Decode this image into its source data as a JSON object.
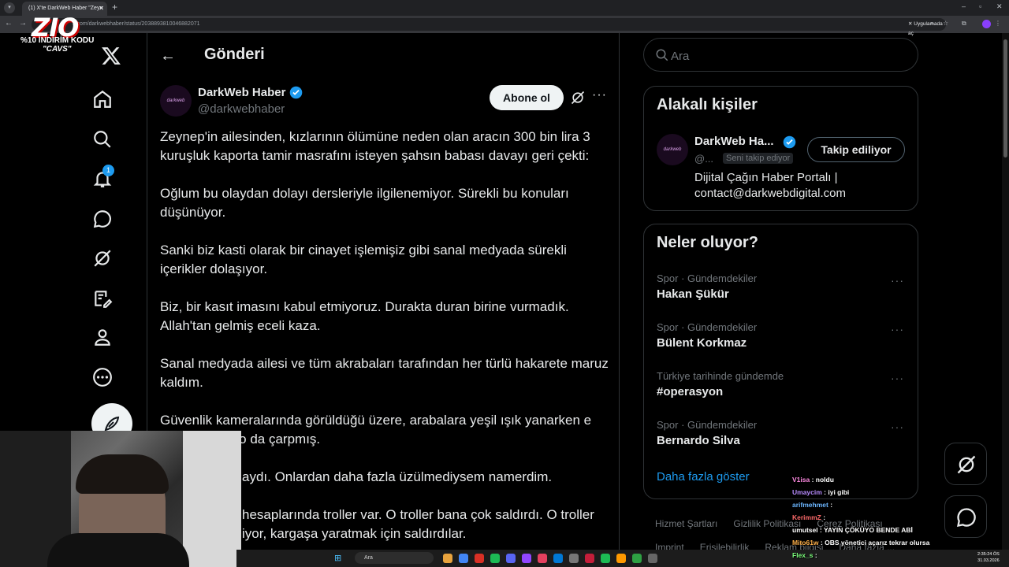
{
  "browser": {
    "tab_title": "(1) X'te DarkWeb Haber \"Zeyn",
    "url": "x.com/darkwebhaber/status/2038893810046882071",
    "app_chip": "Uygulamada aç"
  },
  "overlay_logo": {
    "brand": "ZIO",
    "line1": "%10 İNDİRİM KODU",
    "line2": "\"CAVS\""
  },
  "leftnav": {
    "items": [
      "home-icon",
      "search-icon",
      "bell-icon",
      "chat-icon",
      "grok-icon",
      "edit-icon",
      "profile-icon",
      "more-icon"
    ],
    "notification_count": "1"
  },
  "main": {
    "title": "Gönderi",
    "author": {
      "name": "DarkWeb Haber",
      "handle": "@darkwebhaber",
      "avatar_text": "darkweb"
    },
    "subscribe_label": "Abone ol",
    "paragraphs": [
      "Zeynep'in ailesinden, kızlarının ölümüne neden olan aracın 300 bin lira 3 kuruşluk kaporta tamir masrafını isteyen şahsın babası davayı geri çekti:",
      "Oğlum bu olaydan dolayı dersleriyle ilgilenemiyor. Sürekli bu konuları düşünüyor.",
      "Sanki biz kasti olarak bir cinayet işlemişiz gibi sanal medyada sürekli içerikler dolaşıyor.",
      "Biz, bir kasıt imasını kabul etmiyoruz. Durakta duran birine vurmadık. Allah'tan gelmiş eceli kaza.",
      "Sanal medyada ailesi ve tüm akrabaları tarafından her türlü hakarete maruz kaldım.",
      "Güvenlik kameralarında görüldüğü üzere, arabalara yeşil ışık yanarken e atlanılmış ve o da çarpmış.",
      "aydı. Onlardan daha fazla üzülmediysem namerdim.",
      "hesaplarında troller var. O troller bana çok saldırdı. O troller iyor, kargaşa yaratmak için saldırdılar."
    ]
  },
  "search": {
    "placeholder": "Ara"
  },
  "related": {
    "title": "Alakalı kişiler",
    "name": "DarkWeb Ha...",
    "handle": "@...",
    "follows_you": "Seni takip ediyor",
    "following_label": "Takip ediliyor",
    "bio": "Dijital Çağın Haber Portalı | contact@darkwebdigital.com"
  },
  "trends": {
    "title": "Neler oluyor?",
    "items": [
      {
        "meta": "Spor · Gündemdekiler",
        "name": "Hakan Şükür"
      },
      {
        "meta": "Spor · Gündemdekiler",
        "name": "Bülent Korkmaz"
      },
      {
        "meta": "Türkiye tarihinde gündemde",
        "name": "#operasyon"
      },
      {
        "meta": "Spor · Gündemdekiler",
        "name": "Bernardo Silva"
      }
    ],
    "show_more": "Daha fazla göster"
  },
  "footer": {
    "links": [
      "Hizmet Şartları",
      "Gizlilik Politikası",
      "Çerez Politikası",
      "Imprint",
      "Erişilebilirlik",
      "Reklam bilgisi",
      "Daha fazla ..."
    ]
  },
  "taskbar": {
    "search_text": "Ara",
    "time": "2:35:24 ÖS",
    "date": "31.03.2026"
  },
  "chat": [
    {
      "user": "V1isa",
      "msg": "noldu",
      "color": "#ff8ae2"
    },
    {
      "user": "Umaycim",
      "msg": "iyi gibi",
      "color": "#b88cff"
    },
    {
      "user": "arifmehmet",
      "msg": "",
      "color": "#6cb6ff"
    },
    {
      "user": "KerimmZ",
      "msg": "",
      "color": "#ff6b6b"
    },
    {
      "user": "umutsel",
      "msg": "YAYIN ÇÖKÜYO BENDE ABİ",
      "color": "#ffffff"
    },
    {
      "user": "Mito61w",
      "msg": "OBS yönetici açarız tekrar olursa",
      "color": "#ffb14a"
    },
    {
      "user": "Flex_s",
      "msg": "",
      "color": "#7cff7c"
    }
  ],
  "colors": {
    "accent": "#1d9bf0",
    "background": "#000000",
    "border": "#2f3336",
    "muted": "#71767b"
  }
}
